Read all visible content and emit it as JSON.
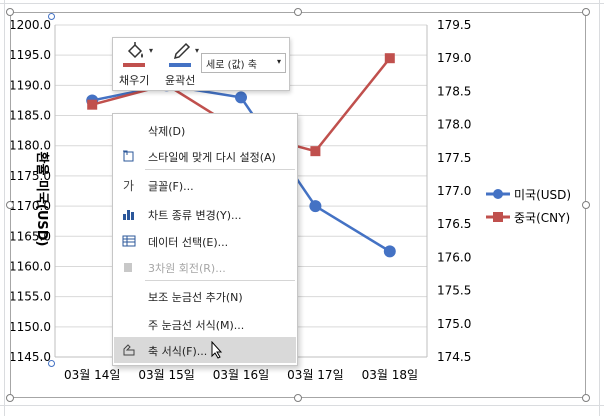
{
  "chart": {
    "y_axis_title": "환율 미국(USD)",
    "left_ticks": [
      "1200.0",
      "1195.0",
      "1190.0",
      "1185.0",
      "1180.0",
      "1175.0",
      "1170.0",
      "1165.0",
      "1160.0",
      "1155.0",
      "1150.0",
      "1145.0"
    ],
    "right_ticks": [
      "179.5",
      "179.0",
      "178.5",
      "178.0",
      "177.5",
      "177.0",
      "176.5",
      "176.0",
      "175.5",
      "175.0",
      "174.5"
    ],
    "x_ticks": [
      "03월 14일",
      "03월 15일",
      "03월 16일",
      "03월 17일",
      "03월 18일"
    ],
    "legend": [
      {
        "label": "미국(USD)",
        "color": "#4472c4"
      },
      {
        "label": "중국(CNY)",
        "color": "#c0504d"
      }
    ]
  },
  "chart_data": {
    "type": "line",
    "categories": [
      "03월 14일",
      "03월 15일",
      "03월 16일",
      "03월 17일",
      "03월 18일"
    ],
    "ylabel": "환율 미국(USD)",
    "ylim": [
      1145,
      1200
    ],
    "y2lim": [
      174.5,
      179.5
    ],
    "grid": true,
    "legend_position": "right",
    "series": [
      {
        "name": "미국(USD)",
        "axis": "left",
        "color": "#4472c4",
        "values": [
          1187.5,
          1190,
          1188,
          1170,
          1162.5
        ]
      },
      {
        "name": "중국(CNY)",
        "axis": "right",
        "color": "#c0504d",
        "values": [
          178.3,
          178.6,
          177.9,
          177.6,
          179.0
        ]
      }
    ]
  },
  "toolbar": {
    "fill_label": "채우기",
    "outline_label": "윤곽선",
    "select_value": "세로 (값) 축",
    "fill_color": "#c0504d",
    "outline_color": "#4472c4"
  },
  "menu": {
    "items": [
      {
        "label": "삭제(D)",
        "icon": "none",
        "disabled": false
      },
      {
        "label": "스타일에 맞게 다시 설정(A)",
        "icon": "reset-style-icon",
        "disabled": false
      },
      {
        "label": "글꼴(F)...",
        "icon": "font-icon",
        "disabled": false
      },
      {
        "label": "차트 종류 변경(Y)...",
        "icon": "chart-type-icon",
        "disabled": false
      },
      {
        "label": "데이터 선택(E)...",
        "icon": "data-table-icon",
        "disabled": false
      },
      {
        "label": "3차원 회전(R)...",
        "icon": "rotate-3d-icon",
        "disabled": true
      },
      {
        "label": "보조 눈금선 추가(N)",
        "icon": "none",
        "disabled": false
      },
      {
        "label": "주 눈금선 서식(M)...",
        "icon": "none",
        "disabled": false
      },
      {
        "label": "축 서식(F)...",
        "icon": "format-axis-icon",
        "disabled": false
      }
    ]
  }
}
